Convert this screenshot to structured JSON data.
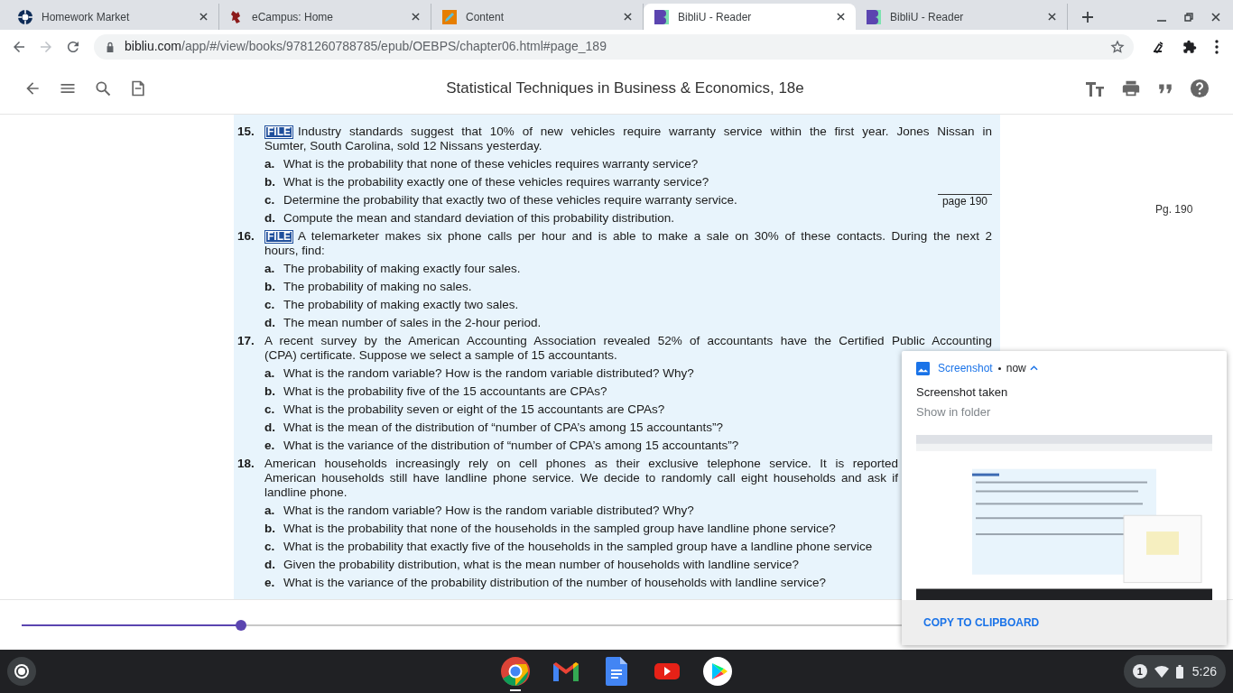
{
  "browser": {
    "tabs": [
      {
        "kind": "homework",
        "title": "Homework Market",
        "selected": false
      },
      {
        "kind": "ecampus",
        "title": "eCampus: Home",
        "selected": false
      },
      {
        "kind": "content",
        "title": "Content",
        "selected": false
      },
      {
        "kind": "bibliu",
        "title": "BibliU - Reader",
        "selected": true
      },
      {
        "kind": "bibliu",
        "title": "BibliU - Reader",
        "selected": false
      }
    ],
    "address_bar": {
      "host": "bibliu.com",
      "path": "/app/#/view/books/9781260788785/epub/OEBPS/chapter06.html#page_189"
    }
  },
  "reader": {
    "title": "Statistical Techniques in Business & Economics, 18e",
    "margin_page": "Pg. 190",
    "questions": [
      {
        "number": "15.",
        "badge": "FILE",
        "lines": [
          "Industry standards suggest that 10% of new vehicles require warranty service within the first year. Jones Nissan in",
          "Sumter, South Carolina, sold 12 Nissans yesterday."
        ],
        "parts": [
          {
            "letter": "a.",
            "text": "What is the probability that none of these vehicles requires warranty service?"
          },
          {
            "letter": "b.",
            "text": "What is the probability exactly one of these vehicles requires warranty service?"
          },
          {
            "letter": "c.",
            "text": "Determine the probability that exactly two of these vehicles require warranty service.",
            "page_marker": "page 190"
          },
          {
            "letter": "d.",
            "text": "Compute the mean and standard deviation of this probability distribution."
          }
        ]
      },
      {
        "number": "16.",
        "badge": "FILE",
        "lines": [
          "A telemarketer makes six phone calls per hour and is able to make a sale on 30% of these contacts. During the next 2",
          "hours, find:"
        ],
        "parts": [
          {
            "letter": "a.",
            "text": "The probability of making exactly four sales."
          },
          {
            "letter": "b.",
            "text": "The probability of making no sales."
          },
          {
            "letter": "c.",
            "text": "The probability of making exactly two sales."
          },
          {
            "letter": "d.",
            "text": "The mean number of sales in the 2-hour period."
          }
        ]
      },
      {
        "number": "17.",
        "lines": [
          "A recent survey by the American Accounting Association revealed 52% of accountants have the Certified Public Accounting",
          "(CPA) certificate. Suppose we select a sample of 15 accountants."
        ],
        "parts": [
          {
            "letter": "a.",
            "text": "What is the random variable? How is the random variable distributed? Why?"
          },
          {
            "letter": "b.",
            "text": "What is the probability five of the 15 accountants are CPAs?"
          },
          {
            "letter": "c.",
            "text": "What is the probability seven or eight of the 15 accountants are CPAs?"
          },
          {
            "letter": "d.",
            "text": "What is the mean of the distribution of “number of CPA’s among 15 accountants”?"
          },
          {
            "letter": "e.",
            "text": "What is the variance of the distribution of “number of CPA’s among 15 accountants”?"
          }
        ]
      },
      {
        "number": "18.",
        "lines": [
          "American households increasingly rely on cell phones as their exclusive telephone service. It is reported",
          "American households still have landline phone service. We decide to randomly call eight households and ask if",
          "landline phone."
        ],
        "parts": [
          {
            "letter": "a.",
            "text": "What is the random variable? How is the random variable distributed? Why?"
          },
          {
            "letter": "b.",
            "text": "What is the probability that none of the households in the sampled group have landline phone service?"
          },
          {
            "letter": "c.",
            "text": "What is the probability that exactly five of the households in the sampled group have a landline phone service"
          },
          {
            "letter": "d.",
            "text": "Given the probability distribution, what is the mean number of households with landline service?"
          },
          {
            "letter": "e.",
            "text": "What is the variance of the probability distribution of the number of households with landline service?"
          }
        ]
      }
    ],
    "progress": {
      "level": 0.184
    }
  },
  "notification": {
    "app": "Screenshot",
    "time": "now",
    "expanded": true,
    "title": "Screenshot taken",
    "subtitle": "Show in folder",
    "action": "COPY TO CLIPBOARD"
  },
  "shelf": {
    "apps": [
      {
        "kind": "chrome",
        "running": true
      },
      {
        "kind": "gmail",
        "running": false
      },
      {
        "kind": "docs",
        "running": false
      },
      {
        "kind": "youtube",
        "running": false
      },
      {
        "kind": "play",
        "running": false
      }
    ],
    "notification_count": "1",
    "time": "5:26"
  }
}
